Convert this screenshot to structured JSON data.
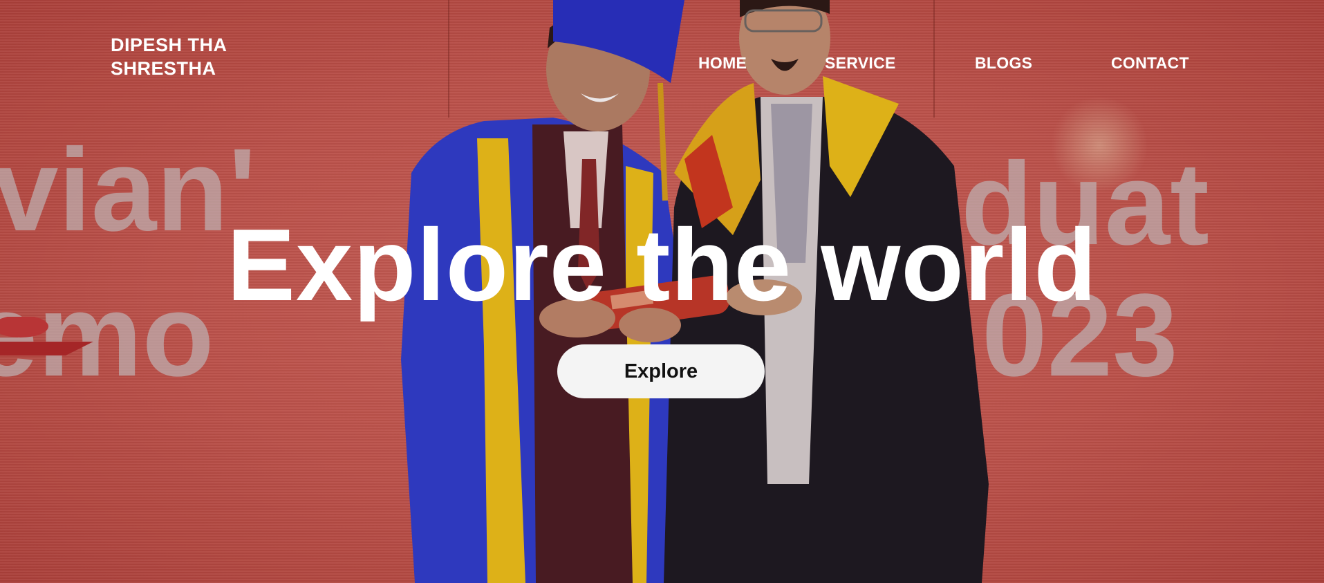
{
  "brand": {
    "line1": "DIPESH THA",
    "line2": "SHRESTHA"
  },
  "nav": [
    {
      "label": "HOME"
    },
    {
      "label": "SERVICE"
    },
    {
      "label": "BLOGS"
    },
    {
      "label": "CONTACT"
    }
  ],
  "hero": {
    "headline": "Explore the world",
    "button_label": "Explore",
    "background_text": [
      "vian'",
      "duat",
      "emo",
      "023"
    ]
  },
  "colors": {
    "backdrop": "#c9584f",
    "headline": "#ffffff",
    "button": "#f4f4f4"
  }
}
